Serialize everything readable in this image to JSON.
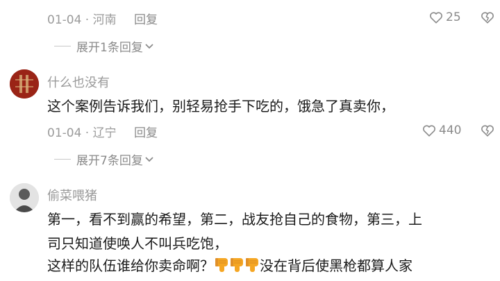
{
  "top_fragment": "",
  "comment1": {
    "date": "01-04",
    "location": "河南",
    "reply_label": "回复",
    "likes": "25",
    "expand_label": "展开1条回复"
  },
  "comment2": {
    "username": "什么也没有",
    "text": "这个案例告诉我们，别轻易抢手下吃的，饿急了真卖你，",
    "date": "01-04",
    "location": "辽宁",
    "reply_label": "回复",
    "likes": "440",
    "expand_label": "展开7条回复"
  },
  "comment3": {
    "username": "偷菜喂猪",
    "line1": "第一，看不到赢的希望，第二，战友抢自己的食物，第三，上",
    "line2": "司只知道使唤人不叫兵吃饱，",
    "line3_start": "这样的队伍谁给你卖命啊？",
    "line3_end": "没在背后使黑枪都算人家",
    "emoji": "thumbs-down-emoji",
    "emoji_count": 3
  },
  "colors": {
    "text": "#1a1a1a",
    "meta": "#9a9a9a",
    "emoji": "#f5a623"
  }
}
